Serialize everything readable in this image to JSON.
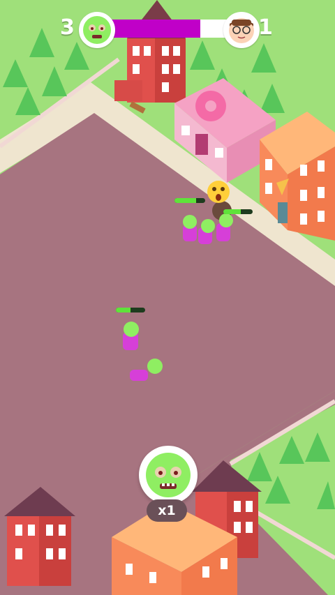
{
  "hud": {
    "zombie_score": "3",
    "human_score": "1",
    "infection_progress": 0.74,
    "colors": {
      "progress": "#c000c8",
      "track": "#ffffff"
    },
    "zombie_avatar_icon": "zombie-face-icon",
    "human_avatar_icon": "human-face-icon"
  },
  "units": {
    "group_hp": [
      0.7,
      0.6
    ],
    "lone_zombie_hp": 0.5
  },
  "bottom": {
    "zombie_button_icon": "zombie-face-icon",
    "multiplier_label": "x1"
  },
  "colors": {
    "ground": "#a77480",
    "grass": "#9fe07a",
    "sidewalk": "#efe5cf",
    "zombie_skin": "#8fee62",
    "zombie_shirt": "#d63fd8"
  }
}
